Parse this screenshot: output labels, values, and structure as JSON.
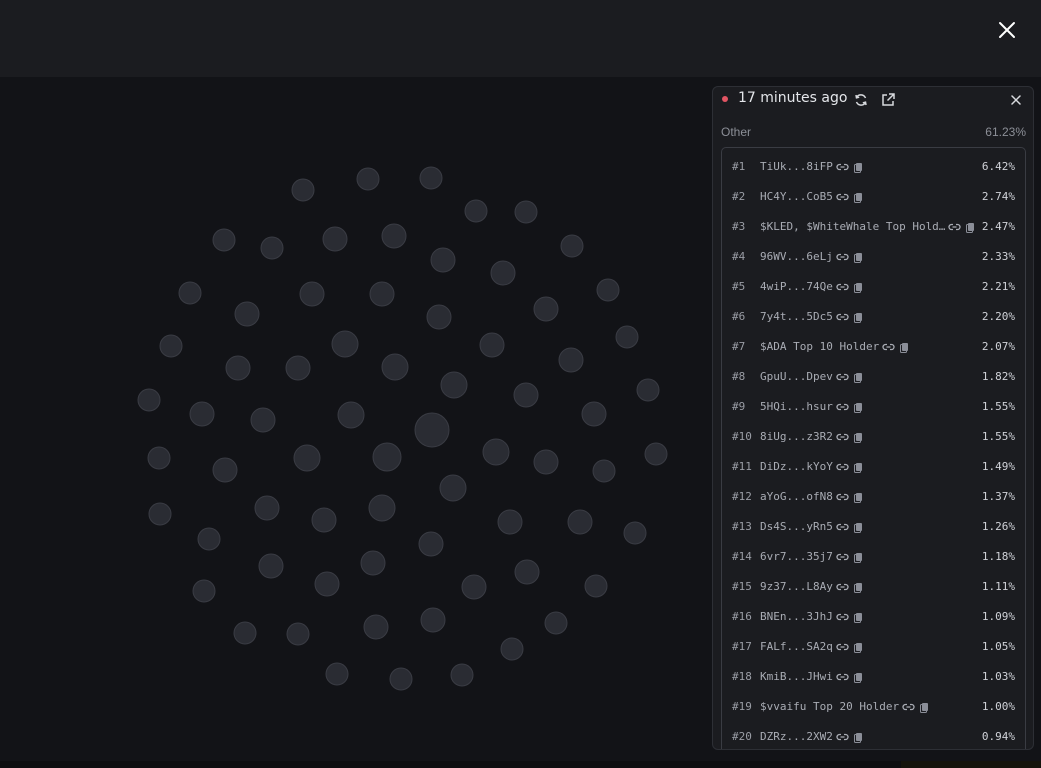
{
  "header": {
    "close_icon": "close-icon"
  },
  "panel": {
    "live_color": "#e25563",
    "time_label": "17 minutes ago",
    "refresh_icon": "refresh-icon",
    "external_icon": "external-link-icon",
    "close_icon": "close-icon",
    "other_label": "Other",
    "other_pct": "61.23%"
  },
  "holders": [
    {
      "rank": "#1",
      "name": "TiUk...8iFP",
      "pct": "6.42%"
    },
    {
      "rank": "#2",
      "name": "HC4Y...CoB5",
      "pct": "2.74%"
    },
    {
      "rank": "#3",
      "name": "$KLED, $WhiteWhale Top Hold…",
      "pct": "2.47%"
    },
    {
      "rank": "#4",
      "name": "96WV...6eLj",
      "pct": "2.33%"
    },
    {
      "rank": "#5",
      "name": "4wiP...74Qe",
      "pct": "2.21%"
    },
    {
      "rank": "#6",
      "name": "7y4t...5Dc5",
      "pct": "2.20%"
    },
    {
      "rank": "#7",
      "name": "$ADA Top 10 Holder",
      "pct": "2.07%"
    },
    {
      "rank": "#8",
      "name": "GpuU...Dpev",
      "pct": "1.82%"
    },
    {
      "rank": "#9",
      "name": "5HQi...hsur",
      "pct": "1.55%"
    },
    {
      "rank": "#10",
      "name": "8iUg...z3R2",
      "pct": "1.55%"
    },
    {
      "rank": "#11",
      "name": "DiDz...kYoY",
      "pct": "1.49%"
    },
    {
      "rank": "#12",
      "name": "aYoG...ofN8",
      "pct": "1.37%"
    },
    {
      "rank": "#13",
      "name": "Ds4S...yRn5",
      "pct": "1.26%"
    },
    {
      "rank": "#14",
      "name": "6vr7...35j7",
      "pct": "1.18%"
    },
    {
      "rank": "#15",
      "name": "9z37...L8Ay",
      "pct": "1.11%"
    },
    {
      "rank": "#16",
      "name": "BNEn...3JhJ",
      "pct": "1.09%"
    },
    {
      "rank": "#17",
      "name": "FALf...SA2q",
      "pct": "1.05%"
    },
    {
      "rank": "#18",
      "name": "KmiB...JHwi",
      "pct": "1.03%"
    },
    {
      "rank": "#19",
      "name": "$vvaifu Top 20 Holder",
      "pct": "1.00%"
    },
    {
      "rank": "#20",
      "name": "DZRz...2XW2",
      "pct": "0.94%"
    }
  ],
  "bubble_color": "#2a2c33",
  "bubble_stroke": "#3a3c44"
}
